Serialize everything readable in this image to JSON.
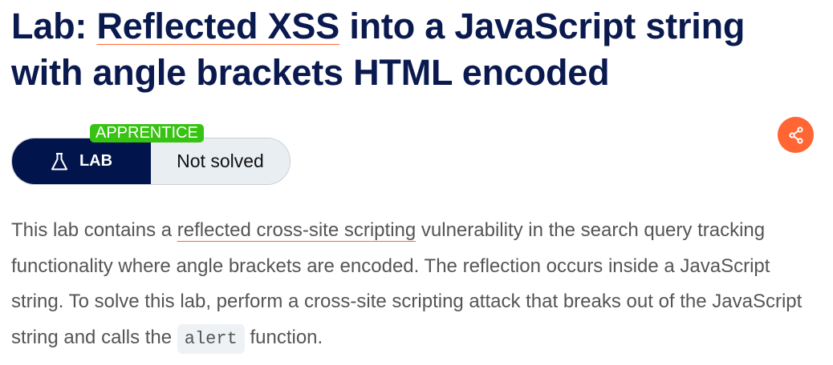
{
  "title": {
    "prefix": "Lab: ",
    "link": "Reflected XSS",
    "suffix": " into a JavaScript string with angle brackets HTML encoded"
  },
  "badge": {
    "level": "APPRENTICE",
    "type": "LAB",
    "status": "Not solved"
  },
  "share": {
    "icon": "share-icon"
  },
  "description": {
    "t1": "This lab contains a ",
    "link": "reflected cross-site scripting",
    "t2": " vulnerability in the search query tracking functionality where angle brackets are encoded. The reflection occurs inside a JavaScript string. To solve this lab, perform a cross-site scripting attack that breaks out of the JavaScript string and calls the ",
    "code": "alert",
    "t3": " function."
  },
  "colors": {
    "navy": "#01144c",
    "accent": "#ff6633",
    "green": "#37c312"
  }
}
